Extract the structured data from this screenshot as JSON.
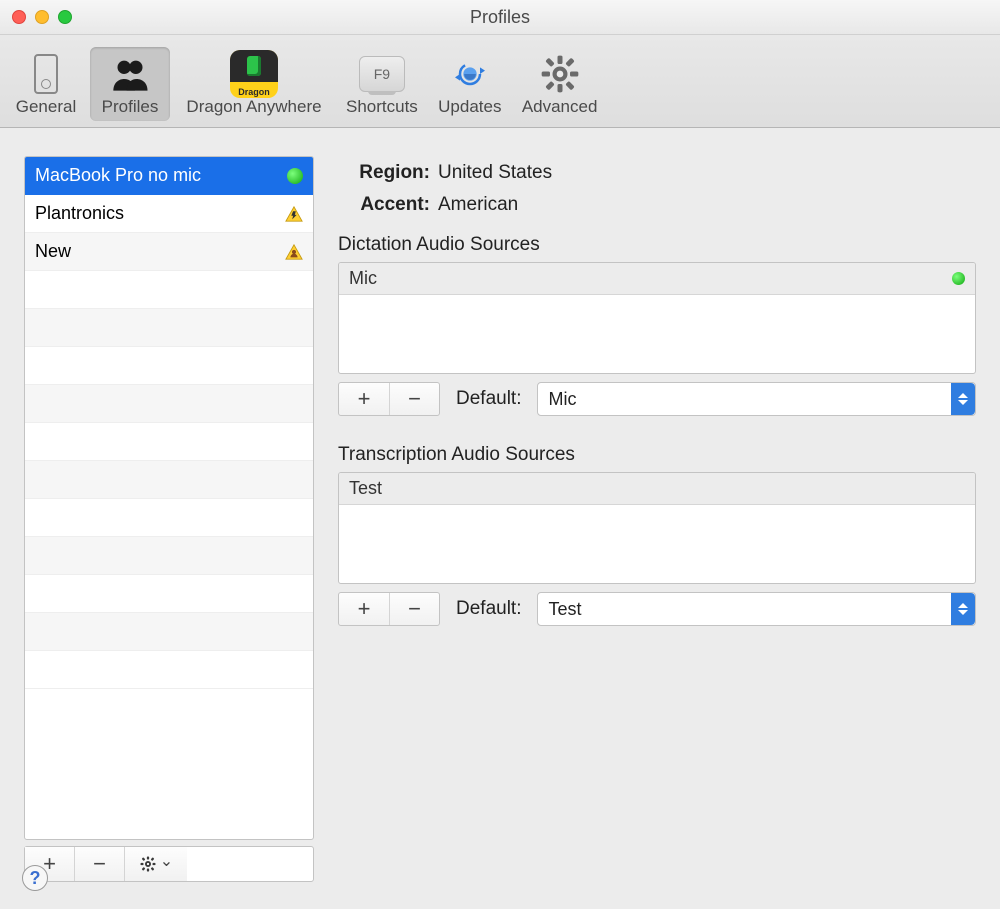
{
  "window": {
    "title": "Profiles"
  },
  "toolbar": {
    "items": [
      {
        "label": "General"
      },
      {
        "label": "Profiles"
      },
      {
        "label": "Dragon Anywhere",
        "badge": "Dragon"
      },
      {
        "label": "Shortcuts",
        "key": "F9"
      },
      {
        "label": "Updates"
      },
      {
        "label": "Advanced"
      }
    ],
    "selected": 1
  },
  "profiles": {
    "items": [
      {
        "name": "MacBook Pro no mic",
        "status": "active"
      },
      {
        "name": "Plantronics",
        "status": "warning-power"
      },
      {
        "name": "New",
        "status": "warning-user"
      }
    ],
    "selected": 0
  },
  "detail": {
    "region_label": "Region:",
    "region_value": "United States",
    "accent_label": "Accent:",
    "accent_value": "American",
    "dictation": {
      "title": "Dictation Audio Sources",
      "items": [
        {
          "name": "Mic",
          "status": "active"
        }
      ],
      "default_label": "Default:",
      "default_value": "Mic"
    },
    "transcription": {
      "title": "Transcription Audio Sources",
      "items": [
        {
          "name": "Test"
        }
      ],
      "default_label": "Default:",
      "default_value": "Test"
    }
  },
  "glyphs": {
    "plus": "+",
    "minus": "−",
    "chevron_down": "⌄",
    "help": "?"
  }
}
